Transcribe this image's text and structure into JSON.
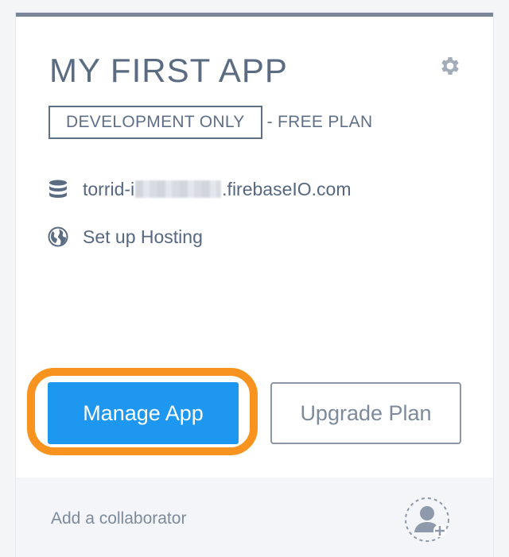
{
  "app": {
    "title": "MY FIRST APP",
    "plan_badge": "DEVELOPMENT ONLY",
    "plan_suffix": "- FREE PLAN",
    "db_url_prefix": "torrid-i",
    "db_url_suffix": ".firebaseIO.com",
    "hosting_label": "Set up Hosting"
  },
  "actions": {
    "manage_label": "Manage App",
    "upgrade_label": "Upgrade Plan"
  },
  "footer": {
    "collaborator_label": "Add a collaborator"
  },
  "icons": {
    "settings": "gear-icon",
    "database": "database-icon",
    "hosting": "globe-icon",
    "collaborator": "add-user-icon"
  },
  "colors": {
    "primary": "#1e97f0",
    "highlight": "#f7931e",
    "text": "#5a6b82",
    "card_top_border": "#7a8599"
  }
}
